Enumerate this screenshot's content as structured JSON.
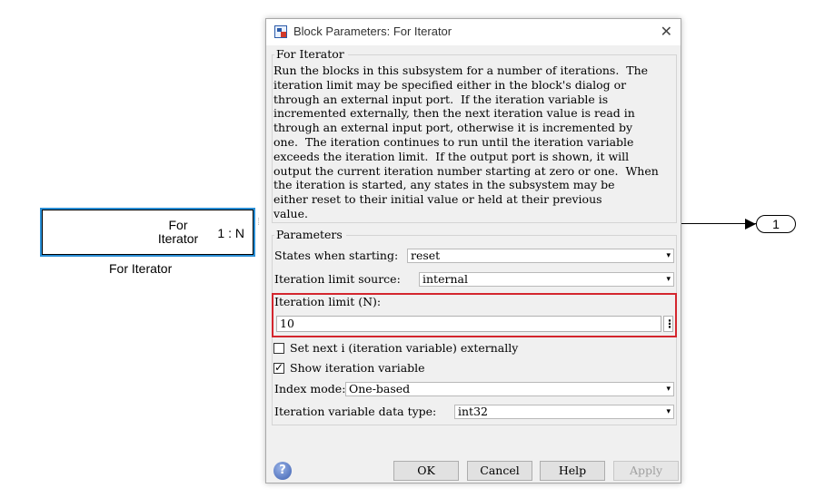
{
  "canvas": {
    "block": {
      "name": "For\nIterator",
      "port_label": "1 : N",
      "caption": "For Iterator"
    },
    "outport_label": "1"
  },
  "dialog": {
    "title": "Block Parameters: For Iterator",
    "close_glyph": "✕",
    "description_group_title": "For Iterator",
    "description": "Run the blocks in this subsystem for a number of iterations.  The\niteration limit may be specified either in the block's dialog or\nthrough an external input port.  If the iteration variable is\nincremented externally, then the next iteration value is read in\nthrough an external input port, otherwise it is incremented by\none.  The iteration continues to run until the iteration variable\nexceeds the iteration limit.  If the output port is shown, it will\noutput the current iteration number starting at zero or one.  When\nthe iteration is started, any states in the subsystem may be\neither reset to their initial value or held at their previous\nvalue.",
    "parameters_group_title": "Parameters",
    "states_when_starting": {
      "label": "States when starting:",
      "value": "reset"
    },
    "iteration_limit_source": {
      "label": "Iteration limit source:",
      "value": "internal"
    },
    "iteration_limit": {
      "label": "Iteration limit (N):",
      "value": "10"
    },
    "set_next_i": {
      "label": "Set next i (iteration variable) externally",
      "checked": false
    },
    "show_iteration_variable": {
      "label": "Show iteration variable",
      "checked": true
    },
    "index_mode": {
      "label": "Index mode:",
      "value": "One-based"
    },
    "iteration_data_type": {
      "label": "Iteration variable data type:",
      "value": "int32"
    },
    "buttons": {
      "ok": "OK",
      "cancel": "Cancel",
      "help": "Help",
      "apply": "Apply"
    },
    "help_glyph": "?"
  },
  "colors": {
    "highlight": "#d4262e",
    "block_border": "#2a8fd6"
  },
  "icons": [
    "block-parameters-icon",
    "close-icon",
    "chevron-down-icon",
    "help-icon",
    "check-icon"
  ]
}
